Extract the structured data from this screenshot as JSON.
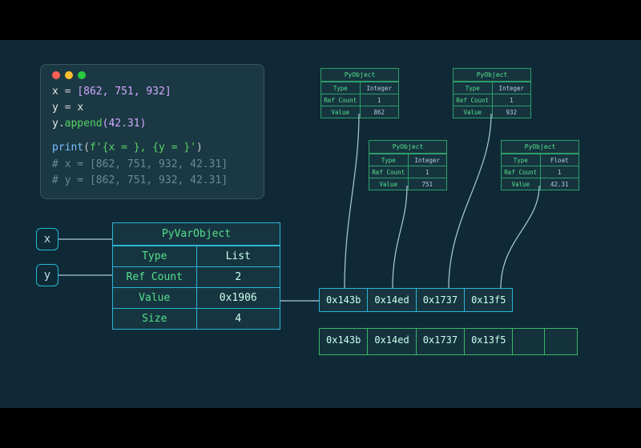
{
  "code": {
    "line1_var": "x",
    "line1_eq": " = ",
    "line1_list": "[862, 751, 932]",
    "line2_var": "y",
    "line2_eq": " = ",
    "line2_rhs": "x",
    "line3_obj": "y",
    "line3_dot": ".",
    "line3_method": "append",
    "line3_arg": "(42.31)",
    "line4_fn": "print",
    "line4_open": "(",
    "line4_str": "f'{x = }, {y = }'",
    "line4_close": ")",
    "comment1": "# x = [862, 751, 932, 42.31]",
    "comment2": "# y = [862, 751, 932, 42.31]"
  },
  "vars": {
    "x": "x",
    "y": "y"
  },
  "pyvar": {
    "title": "PyVarObject",
    "rows": {
      "type_k": "Type",
      "type_v": "List",
      "rc_k": "Ref Count",
      "rc_v": "2",
      "val_k": "Value",
      "val_v": "0x1906",
      "size_k": "Size",
      "size_v": "4"
    }
  },
  "pyobjects": [
    {
      "title": "PyObject",
      "type": "Integer",
      "rc": "1",
      "value": "862"
    },
    {
      "title": "PyObject",
      "type": "Integer",
      "rc": "1",
      "value": "751"
    },
    {
      "title": "PyObject",
      "type": "Integer",
      "rc": "1",
      "value": "932"
    },
    {
      "title": "PyObject",
      "type": "Float",
      "rc": "1",
      "value": "42.31"
    }
  ],
  "pointer_cells": [
    "0x143b",
    "0x14ed",
    "0x1737",
    "0x13f5"
  ],
  "buffer_cells": [
    "0x143b",
    "0x14ed",
    "0x1737",
    "0x13f5",
    "",
    ""
  ],
  "labels": {
    "type": "Type",
    "refcount": "Ref Count",
    "value": "Value"
  }
}
